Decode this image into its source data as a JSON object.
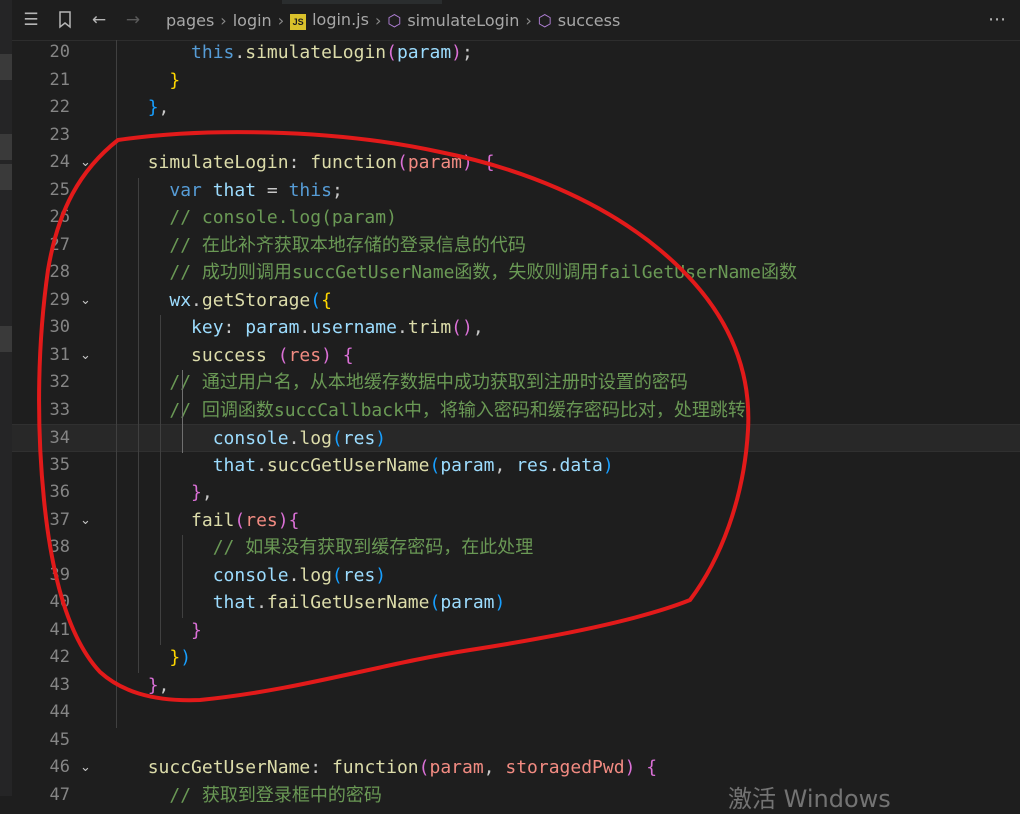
{
  "breadcrumbs": {
    "segments": [
      "pages",
      "login",
      "login.js",
      "simulateLogin",
      "success"
    ],
    "js_badge": "JS"
  },
  "icons": [
    "list-icon",
    "bookmark-icon",
    "arrow-left-icon",
    "arrow-right-icon",
    "more-icon",
    "js-file-icon",
    "cube-icon",
    "chevron-down-icon"
  ],
  "colors": {
    "keyword": "#569cd6",
    "function": "#dcdcaa",
    "variable": "#9cdcfe",
    "comment": "#6a9955",
    "bracket_gold": "#ffd700",
    "bracket_pink": "#da70d6",
    "bracket_blue": "#179fff",
    "annotation": "#e21a1a",
    "js_badge": "#d9c12b"
  },
  "editor": {
    "active_line": 34,
    "lines": [
      {
        "n": "20",
        "fold": false,
        "tokens": [
          [
            "      ",
            ""
          ],
          [
            "this",
            "k"
          ],
          [
            ".",
            "p"
          ],
          [
            "simulateLogin",
            "f"
          ],
          [
            "(",
            "b2"
          ],
          [
            "param",
            "v"
          ],
          [
            ")",
            "b2"
          ],
          [
            ";",
            "p"
          ]
        ]
      },
      {
        "n": "21",
        "fold": false,
        "tokens": [
          [
            "    ",
            ""
          ],
          [
            "}",
            "b1"
          ]
        ]
      },
      {
        "n": "22",
        "fold": false,
        "tokens": [
          [
            "  ",
            ""
          ],
          [
            "}",
            "b3"
          ],
          [
            ",",
            "p"
          ]
        ]
      },
      {
        "n": "23",
        "fold": false,
        "tokens": []
      },
      {
        "n": "24",
        "fold": true,
        "tokens": [
          [
            "  ",
            ""
          ],
          [
            "simulateLogin",
            "f"
          ],
          [
            ": ",
            "p"
          ],
          [
            "function",
            "f"
          ],
          [
            "(",
            "b2"
          ],
          [
            "param",
            "pr"
          ],
          [
            ")",
            "b2"
          ],
          [
            " ",
            ""
          ],
          [
            "{",
            "b2"
          ]
        ]
      },
      {
        "n": "25",
        "fold": false,
        "tokens": [
          [
            "    ",
            ""
          ],
          [
            "var",
            "k"
          ],
          [
            " ",
            ""
          ],
          [
            "that",
            "v"
          ],
          [
            " = ",
            "p"
          ],
          [
            "this",
            "k"
          ],
          [
            ";",
            "p"
          ]
        ]
      },
      {
        "n": "26",
        "fold": false,
        "tokens": [
          [
            "    ",
            ""
          ],
          [
            "// console.log(param)",
            "c"
          ]
        ]
      },
      {
        "n": "27",
        "fold": false,
        "tokens": [
          [
            "    ",
            ""
          ],
          [
            "// 在此补齐获取本地存储的登录信息的代码",
            "c"
          ]
        ]
      },
      {
        "n": "28",
        "fold": false,
        "tokens": [
          [
            "    ",
            ""
          ],
          [
            "// 成功则调用succGetUserName函数，失败则调用failGetUserName函数",
            "c"
          ]
        ]
      },
      {
        "n": "29",
        "fold": true,
        "tokens": [
          [
            "    ",
            ""
          ],
          [
            "wx",
            "v"
          ],
          [
            ".",
            "p"
          ],
          [
            "getStorage",
            "f"
          ],
          [
            "(",
            "b3"
          ],
          [
            "{",
            "b1"
          ]
        ]
      },
      {
        "n": "30",
        "fold": false,
        "tokens": [
          [
            "      ",
            ""
          ],
          [
            "key",
            "v"
          ],
          [
            ": ",
            "p"
          ],
          [
            "param",
            "v"
          ],
          [
            ".",
            "p"
          ],
          [
            "username",
            "v"
          ],
          [
            ".",
            "p"
          ],
          [
            "trim",
            "f"
          ],
          [
            "()",
            "b2"
          ],
          [
            ",",
            "p"
          ]
        ]
      },
      {
        "n": "31",
        "fold": true,
        "tokens": [
          [
            "      ",
            ""
          ],
          [
            "success",
            "f"
          ],
          [
            " ",
            ""
          ],
          [
            "(",
            "b2"
          ],
          [
            "res",
            "pr"
          ],
          [
            ")",
            "b2"
          ],
          [
            " ",
            ""
          ],
          [
            "{",
            "b2"
          ]
        ]
      },
      {
        "n": "32",
        "fold": false,
        "tokens": [
          [
            "    ",
            ""
          ],
          [
            "// 通过用户名，从本地缓存数据中成功获取到注册时设置的密码",
            "c"
          ]
        ]
      },
      {
        "n": "33",
        "fold": false,
        "tokens": [
          [
            "    ",
            ""
          ],
          [
            "// 回调函数succCallback中，将输入密码和缓存密码比对，处理跳转",
            "c"
          ]
        ]
      },
      {
        "n": "34",
        "fold": false,
        "tokens": [
          [
            "        ",
            ""
          ],
          [
            "console",
            "v"
          ],
          [
            ".",
            "p"
          ],
          [
            "log",
            "f"
          ],
          [
            "(",
            "b3"
          ],
          [
            "res",
            "v"
          ],
          [
            ")",
            "b3"
          ]
        ]
      },
      {
        "n": "35",
        "fold": false,
        "tokens": [
          [
            "        ",
            ""
          ],
          [
            "that",
            "v"
          ],
          [
            ".",
            "p"
          ],
          [
            "succGetUserName",
            "f"
          ],
          [
            "(",
            "b3"
          ],
          [
            "param",
            "v"
          ],
          [
            ", ",
            "p"
          ],
          [
            "res",
            "v"
          ],
          [
            ".",
            "p"
          ],
          [
            "data",
            "v"
          ],
          [
            ")",
            "b3"
          ]
        ]
      },
      {
        "n": "36",
        "fold": false,
        "tokens": [
          [
            "      ",
            ""
          ],
          [
            "}",
            "b2"
          ],
          [
            ",",
            "p"
          ]
        ]
      },
      {
        "n": "37",
        "fold": true,
        "tokens": [
          [
            "      ",
            ""
          ],
          [
            "fail",
            "f"
          ],
          [
            "(",
            "b2"
          ],
          [
            "res",
            "pr"
          ],
          [
            ")",
            "b2"
          ],
          [
            "{",
            "b2"
          ]
        ]
      },
      {
        "n": "38",
        "fold": false,
        "tokens": [
          [
            "        ",
            ""
          ],
          [
            "// 如果没有获取到缓存密码，在此处理",
            "c"
          ]
        ]
      },
      {
        "n": "39",
        "fold": false,
        "tokens": [
          [
            "        ",
            ""
          ],
          [
            "console",
            "v"
          ],
          [
            ".",
            "p"
          ],
          [
            "log",
            "f"
          ],
          [
            "(",
            "b3"
          ],
          [
            "res",
            "v"
          ],
          [
            ")",
            "b3"
          ]
        ]
      },
      {
        "n": "40",
        "fold": false,
        "tokens": [
          [
            "        ",
            ""
          ],
          [
            "that",
            "v"
          ],
          [
            ".",
            "p"
          ],
          [
            "failGetUserName",
            "f"
          ],
          [
            "(",
            "b3"
          ],
          [
            "param",
            "v"
          ],
          [
            ")",
            "b3"
          ]
        ]
      },
      {
        "n": "41",
        "fold": false,
        "tokens": [
          [
            "      ",
            ""
          ],
          [
            "}",
            "b2"
          ]
        ]
      },
      {
        "n": "42",
        "fold": false,
        "tokens": [
          [
            "    ",
            ""
          ],
          [
            "}",
            "b1"
          ],
          [
            ")",
            "b3"
          ]
        ]
      },
      {
        "n": "43",
        "fold": false,
        "tokens": [
          [
            "  ",
            ""
          ],
          [
            "}",
            "b2"
          ],
          [
            ",",
            "p"
          ]
        ]
      },
      {
        "n": "44",
        "fold": false,
        "tokens": []
      },
      {
        "n": "45",
        "fold": false,
        "tokens": []
      },
      {
        "n": "46",
        "fold": true,
        "tokens": [
          [
            "  ",
            ""
          ],
          [
            "succGetUserName",
            "f"
          ],
          [
            ": ",
            "p"
          ],
          [
            "function",
            "f"
          ],
          [
            "(",
            "b2"
          ],
          [
            "param",
            "pr"
          ],
          [
            ", ",
            "p"
          ],
          [
            "storagedPwd",
            "pr"
          ],
          [
            ")",
            "b2"
          ],
          [
            " ",
            ""
          ],
          [
            "{",
            "b2"
          ]
        ]
      },
      {
        "n": "47",
        "fold": false,
        "tokens": [
          [
            "    ",
            ""
          ],
          [
            "// 获取到登录框中的密码",
            "c"
          ]
        ]
      }
    ]
  },
  "watermark": "激活 Windows"
}
